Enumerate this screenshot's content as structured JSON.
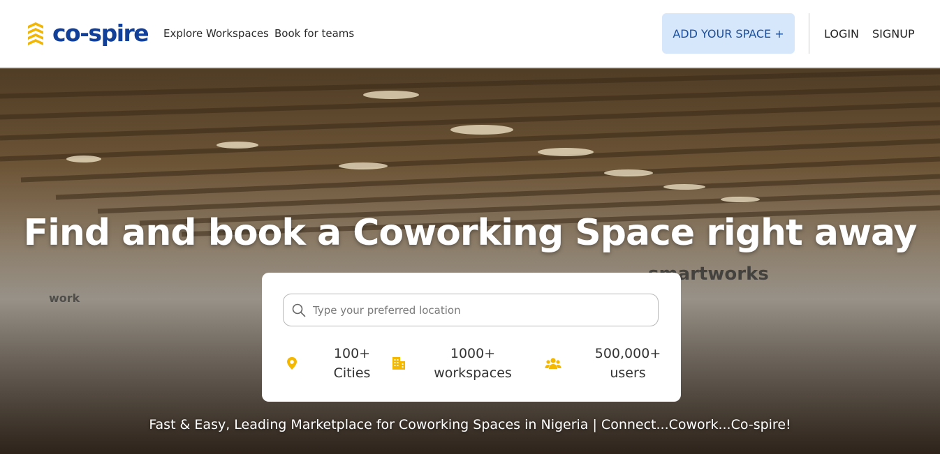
{
  "brand": {
    "name": "co-spire",
    "logo_color": "#123f97",
    "mark_color": "#f2b705"
  },
  "nav": {
    "links": [
      "Explore Workspaces",
      "Book for teams"
    ],
    "add_space_label": "ADD YOUR SPACE +",
    "login_label": "LOGIN",
    "signup_label": "SIGNUP"
  },
  "hero": {
    "title": "Find and book a Coworking Space right away",
    "tagline": "Fast & Easy, Leading Marketplace for Coworking Spaces in Nigeria | Connect...Cowork...Co-spire!",
    "background_signage": {
      "right": "smartworks",
      "left": "work"
    }
  },
  "search": {
    "placeholder": "Type your preferred location",
    "value": ""
  },
  "stats": [
    {
      "icon": "location-pin-icon",
      "line1": "100+",
      "line2": "Cities"
    },
    {
      "icon": "building-icon",
      "line1": "1000+",
      "line2": "workspaces"
    },
    {
      "icon": "users-icon",
      "line1": "500,000+",
      "line2": "users"
    }
  ],
  "colors": {
    "accent": "#f5b800",
    "button_bg": "#d7e7fb",
    "button_text": "#1b4e9b"
  }
}
